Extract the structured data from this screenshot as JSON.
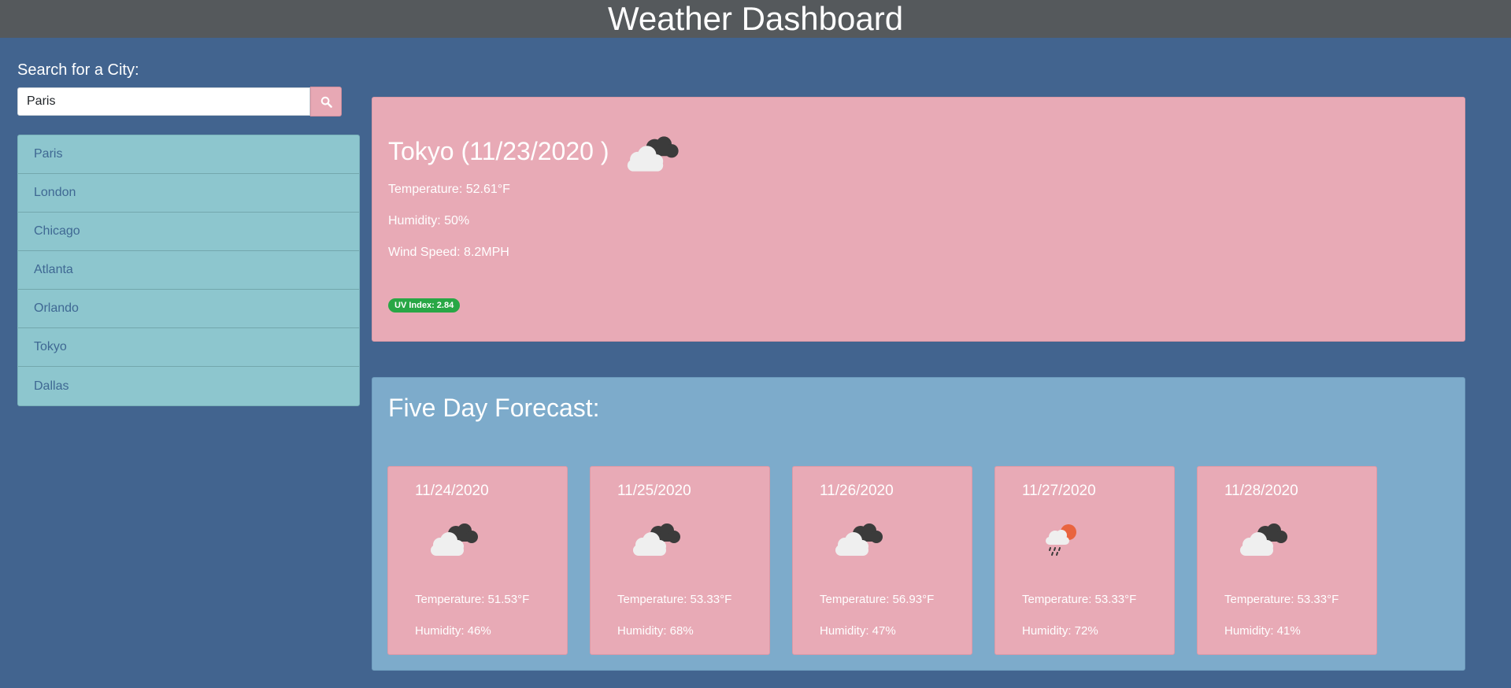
{
  "header": {
    "title": "Weather Dashboard"
  },
  "search": {
    "label": "Search for a City:",
    "value": "Paris",
    "button_icon": "search-icon",
    "button_color": "#e7a8b4"
  },
  "history": {
    "cities": [
      "Paris",
      "London",
      "Chicago",
      "Atlanta",
      "Orlando",
      "Tokyo",
      "Dallas"
    ]
  },
  "current": {
    "title": "Tokyo (11/23/2020 )",
    "icon": "broken-clouds-icon",
    "temperature": "Temperature: 52.61°F",
    "humidity": "Humidity: 50%",
    "wind": "Wind Speed: 8.2MPH",
    "uv": "UV Index: 2.84",
    "uv_color": "#28a745"
  },
  "forecast": {
    "title": "Five Day Forecast:",
    "days": [
      {
        "date": "11/24/2020",
        "icon": "broken-clouds-icon",
        "temp": "Temperature: 51.53°F",
        "humidity": "Humidity: 46%"
      },
      {
        "date": "11/25/2020",
        "icon": "broken-clouds-icon",
        "temp": "Temperature: 53.33°F",
        "humidity": "Humidity: 68%"
      },
      {
        "date": "11/26/2020",
        "icon": "broken-clouds-icon",
        "temp": "Temperature: 56.93°F",
        "humidity": "Humidity: 47%"
      },
      {
        "date": "11/27/2020",
        "icon": "rain-sun-icon",
        "temp": "Temperature: 53.33°F",
        "humidity": "Humidity: 72%"
      },
      {
        "date": "11/28/2020",
        "icon": "broken-clouds-icon",
        "temp": "Temperature: 53.33°F",
        "humidity": "Humidity: 41%"
      }
    ]
  },
  "colors": {
    "background": "#42648f",
    "header": "#55595c",
    "card": "#e8aab6",
    "forecast_panel": "#7dabcb",
    "city_list": "#8dc6ce",
    "city_text": "#3f6893"
  }
}
